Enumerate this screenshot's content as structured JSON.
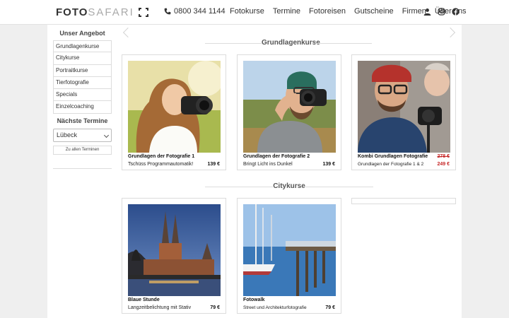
{
  "header": {
    "logo_bold": "FOTO",
    "logo_light": "SAFARI",
    "phone": "0800 344 1144",
    "nav": [
      "Fotokurse",
      "Termine",
      "Fotoreisen",
      "Gutscheine",
      "Firmen",
      "Über uns"
    ],
    "icons": [
      "user-icon",
      "instagram-icon",
      "facebook-icon"
    ]
  },
  "sidebar": {
    "title": "Unser Angebot",
    "items": [
      "Grundlagenkurse",
      "Citykurse",
      "Portraitkurse",
      "Tierfotografie",
      "Specials",
      "Einzelcoaching"
    ],
    "dates_title": "Nächste Termine",
    "city_select": "Lübeck",
    "all_dates_button": "Zu allen Terminen"
  },
  "sections": {
    "grundlagen": {
      "title": "Grundlagenkurse",
      "cards": [
        {
          "title": "Grundlagen der Fotografie 1",
          "subtitle": "Tschüss Programmautomatik!",
          "price": "139 €"
        },
        {
          "title": "Grundlagen der Fotografie 2",
          "subtitle": "Bringt Licht ins Dunkel",
          "price": "139 €"
        },
        {
          "title": "Kombi Grundlagen Fotografie",
          "subtitle": "Grundlagen der Fotografie 1 & 2",
          "old_price": "278 €",
          "price": "249 €"
        }
      ]
    },
    "city": {
      "title": "Citykurse",
      "cards": [
        {
          "title": "Blaue Stunde",
          "subtitle": "Langzeitbelichtung mit Stativ",
          "price": "79 €"
        },
        {
          "title": "Fotowalk",
          "subtitle": "Street und Architekturfotografie",
          "price": "79 €"
        }
      ]
    }
  },
  "colors": {
    "sale": "#c62828",
    "border": "#dcdcdc",
    "background": "#efefef"
  }
}
